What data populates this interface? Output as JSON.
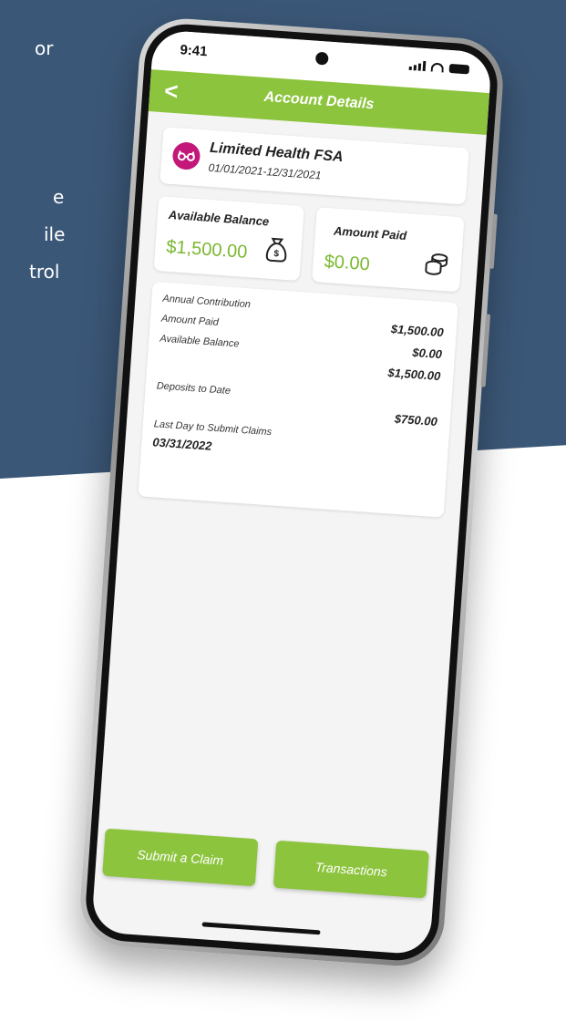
{
  "background": {
    "lines": [
      "or",
      "e",
      "ile",
      "trol"
    ]
  },
  "status_bar": {
    "time": "9:41"
  },
  "nav": {
    "back_label": "<",
    "title": "Account Details"
  },
  "plan": {
    "icon": "glasses-icon",
    "icon_glyph": "6-ð",
    "name": "Limited Health FSA",
    "dates": "01/01/2021-12/31/2021"
  },
  "available_balance": {
    "label": "Available Balance",
    "value": "$1,500.00",
    "icon": "money-bag-icon"
  },
  "amount_paid": {
    "label": "Amount Paid",
    "value": "$0.00",
    "icon": "coins-icon"
  },
  "details": {
    "labels": {
      "annual_contribution": "Annual Contribution",
      "amount_paid": "Amount Paid",
      "available_balance": "Available Balance",
      "deposits_to_date": "Deposits to Date",
      "last_day": "Last Day to Submit Claims"
    },
    "values": {
      "annual_contribution": "$1,500.00",
      "amount_paid": "$0.00",
      "available_balance": "$1,500.00",
      "deposits_to_date": "$750.00",
      "last_day": "03/31/2022"
    }
  },
  "buttons": {
    "submit_claim": "Submit a Claim",
    "transactions": "Transactions"
  },
  "colors": {
    "accent": "#8cc43e",
    "value_green": "#7ab72f",
    "plan_icon": "#c3177a",
    "background_blue": "#3b5777"
  }
}
